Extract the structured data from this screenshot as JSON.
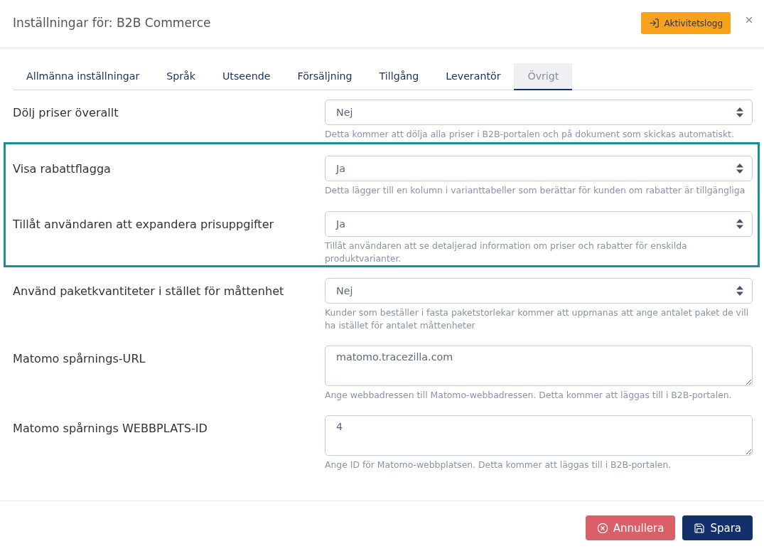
{
  "dialog": {
    "title": "Inställningar för: B2B Commerce",
    "activity_log_button": "Aktivitetslogg"
  },
  "tabs": [
    {
      "label": "Allmänna inställningar",
      "selected": false
    },
    {
      "label": "Språk",
      "selected": false
    },
    {
      "label": "Utseende",
      "selected": false
    },
    {
      "label": "Försäljning",
      "selected": false
    },
    {
      "label": "Tillgång",
      "selected": false
    },
    {
      "label": "Leverantör",
      "selected": false
    },
    {
      "label": "Övrigt",
      "selected": true
    }
  ],
  "settings": [
    {
      "label": "Dölj priser överallt",
      "kind": "select",
      "value": "Nej",
      "help": "Detta kommer att dölja alla priser i B2B-portalen och på dokument som skickas automatiskt.",
      "highlighted": false
    },
    {
      "label": "Visa rabattflagga",
      "kind": "select",
      "value": "Ja",
      "help": "Detta lägger till en kolumn i varianttabeller som berättar för kunden om rabatter är tillgängliga",
      "highlighted": true
    },
    {
      "label": "Tillåt användaren att expandera prisuppgifter",
      "kind": "select",
      "value": "Ja",
      "help": "Tillåt användaren att se detaljerad information om priser och rabatter för enskilda produktvarianter.",
      "highlighted": true
    },
    {
      "label": "Använd paketkvantiteter i stället för måttenhet",
      "kind": "select",
      "value": "Nej",
      "help": "Kunder som beställer i fasta paketstorlekar kommer att uppmanas att ange antalet paket de vill ha istället för antalet måttenheter",
      "highlighted": false
    },
    {
      "label": "Matomo spårnings-URL",
      "kind": "textarea",
      "value": "matomo.tracezilla.com",
      "help": "Ange webbadressen till Matomo-webbadressen. Detta kommer att läggas till i B2B-portalen.",
      "highlighted": false
    },
    {
      "label": "Matomo spårnings WEBBPLATS-ID",
      "kind": "textarea",
      "value": "4",
      "help": "Ange ID för Matomo-webbplatsen. Detta kommer att läggas till i B2B-portalen.",
      "highlighted": false
    }
  ],
  "footer": {
    "buttons": [
      {
        "label": "Annullera",
        "kind": "cancel"
      },
      {
        "label": "Spara",
        "kind": "save"
      }
    ]
  }
}
